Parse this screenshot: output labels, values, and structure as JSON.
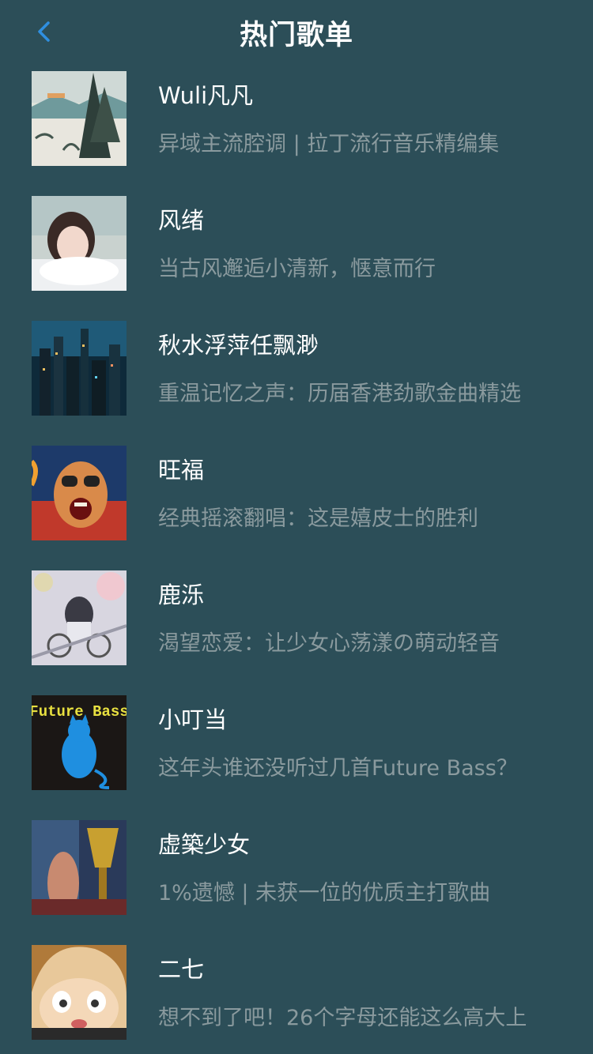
{
  "header": {
    "title": "热门歌单",
    "back_icon": "chevron-left-icon",
    "accent_color": "#2f8fe0"
  },
  "playlists": [
    {
      "name": "Wuli凡凡",
      "desc": "异域主流腔调 | 拉丁流行音乐精编集"
    },
    {
      "name": "风绪",
      "desc": "当古风邂逅小清新，惬意而行"
    },
    {
      "name": "秋水浮萍任飘渺",
      "desc": "重温记忆之声：历届香港劲歌金曲精选"
    },
    {
      "name": "旺福",
      "desc": "经典摇滚翻唱：这是嬉皮士的胜利"
    },
    {
      "name": "鹿泺",
      "desc": "渴望恋爱：让少女心荡漾の萌动轻音"
    },
    {
      "name": "小叮当",
      "desc": "这年头谁还没听过几首Future Bass？",
      "cover_text": "Future Bass"
    },
    {
      "name": "虚築少女",
      "desc": "1%遗憾 | 未获一位的优质主打歌曲"
    },
    {
      "name": "二七",
      "desc": "想不到了吧！26个字母还能这么高大上"
    }
  ],
  "colors": {
    "background": "#2c4e58",
    "title_text": "#ffffff",
    "desc_text": "#8a9a9e"
  }
}
